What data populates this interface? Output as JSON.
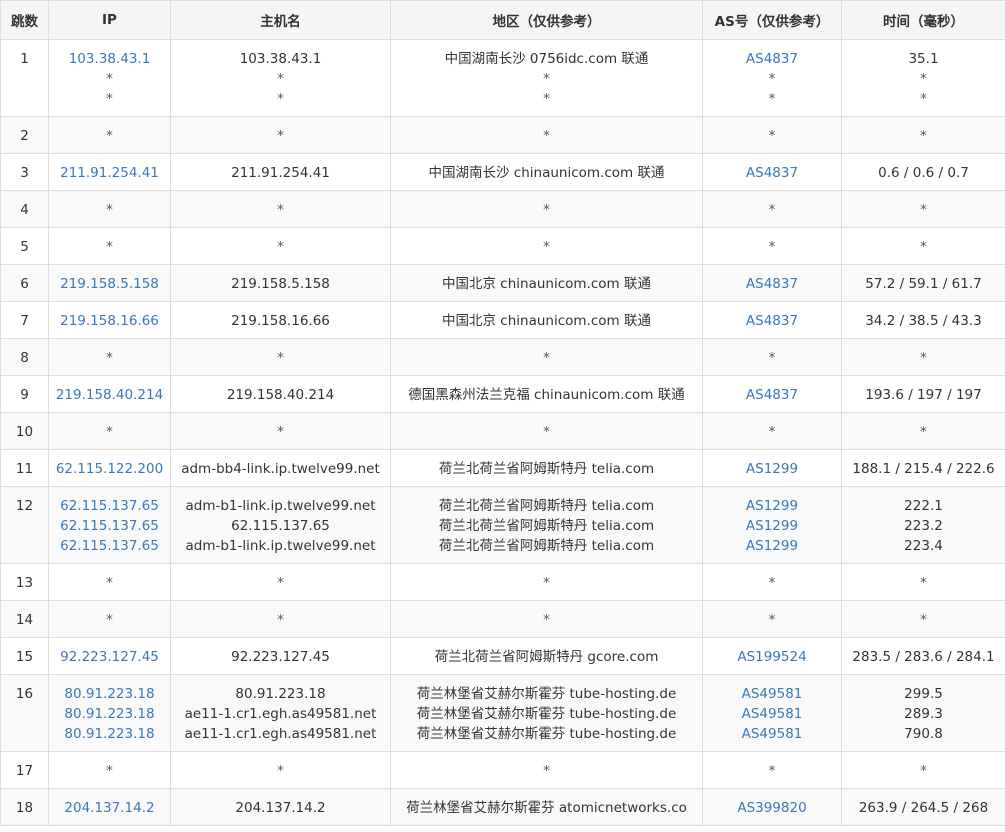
{
  "headers": [
    "跳数",
    "IP",
    "主机名",
    "地区（仅供参考）",
    "AS号（仅供参考）",
    "时间（毫秒）"
  ],
  "rows": [
    {
      "hop": "1",
      "ip": [
        "103.38.43.1",
        "*",
        "*"
      ],
      "host": [
        "103.38.43.1",
        "*",
        "*"
      ],
      "region": [
        "中国湖南长沙 0756idc.com 联通",
        "*",
        "*"
      ],
      "as": [
        "AS4837",
        "*",
        "*"
      ],
      "time": [
        "35.1",
        "*",
        "*"
      ]
    },
    {
      "hop": "2",
      "ip": [
        "*"
      ],
      "host": [
        "*"
      ],
      "region": [
        "*"
      ],
      "as": [
        "*"
      ],
      "time": [
        "*"
      ]
    },
    {
      "hop": "3",
      "ip": [
        "211.91.254.41"
      ],
      "host": [
        "211.91.254.41"
      ],
      "region": [
        "中国湖南长沙 chinaunicom.com 联通"
      ],
      "as": [
        "AS4837"
      ],
      "time": [
        "0.6 / 0.6 / 0.7"
      ]
    },
    {
      "hop": "4",
      "ip": [
        "*"
      ],
      "host": [
        "*"
      ],
      "region": [
        "*"
      ],
      "as": [
        "*"
      ],
      "time": [
        "*"
      ]
    },
    {
      "hop": "5",
      "ip": [
        "*"
      ],
      "host": [
        "*"
      ],
      "region": [
        "*"
      ],
      "as": [
        "*"
      ],
      "time": [
        "*"
      ]
    },
    {
      "hop": "6",
      "ip": [
        "219.158.5.158"
      ],
      "host": [
        "219.158.5.158"
      ],
      "region": [
        "中国北京 chinaunicom.com 联通"
      ],
      "as": [
        "AS4837"
      ],
      "time": [
        "57.2 / 59.1 / 61.7"
      ]
    },
    {
      "hop": "7",
      "ip": [
        "219.158.16.66"
      ],
      "host": [
        "219.158.16.66"
      ],
      "region": [
        "中国北京 chinaunicom.com 联通"
      ],
      "as": [
        "AS4837"
      ],
      "time": [
        "34.2 / 38.5 / 43.3"
      ]
    },
    {
      "hop": "8",
      "ip": [
        "*"
      ],
      "host": [
        "*"
      ],
      "region": [
        "*"
      ],
      "as": [
        "*"
      ],
      "time": [
        "*"
      ]
    },
    {
      "hop": "9",
      "ip": [
        "219.158.40.214"
      ],
      "host": [
        "219.158.40.214"
      ],
      "region": [
        "德国黑森州法兰克福 chinaunicom.com 联通"
      ],
      "as": [
        "AS4837"
      ],
      "time": [
        "193.6 / 197 / 197"
      ]
    },
    {
      "hop": "10",
      "ip": [
        "*"
      ],
      "host": [
        "*"
      ],
      "region": [
        "*"
      ],
      "as": [
        "*"
      ],
      "time": [
        "*"
      ]
    },
    {
      "hop": "11",
      "ip": [
        "62.115.122.200"
      ],
      "host": [
        "adm-bb4-link.ip.twelve99.net"
      ],
      "region": [
        "荷兰北荷兰省阿姆斯特丹 telia.com"
      ],
      "as": [
        "AS1299"
      ],
      "time": [
        "188.1 / 215.4 / 222.6"
      ]
    },
    {
      "hop": "12",
      "ip": [
        "62.115.137.65",
        "62.115.137.65",
        "62.115.137.65"
      ],
      "host": [
        "adm-b1-link.ip.twelve99.net",
        "62.115.137.65",
        "adm-b1-link.ip.twelve99.net"
      ],
      "region": [
        "荷兰北荷兰省阿姆斯特丹 telia.com",
        "荷兰北荷兰省阿姆斯特丹 telia.com",
        "荷兰北荷兰省阿姆斯特丹 telia.com"
      ],
      "as": [
        "AS1299",
        "AS1299",
        "AS1299"
      ],
      "time": [
        "222.1",
        "223.2",
        "223.4"
      ]
    },
    {
      "hop": "13",
      "ip": [
        "*"
      ],
      "host": [
        "*"
      ],
      "region": [
        "*"
      ],
      "as": [
        "*"
      ],
      "time": [
        "*"
      ]
    },
    {
      "hop": "14",
      "ip": [
        "*"
      ],
      "host": [
        "*"
      ],
      "region": [
        "*"
      ],
      "as": [
        "*"
      ],
      "time": [
        "*"
      ]
    },
    {
      "hop": "15",
      "ip": [
        "92.223.127.45"
      ],
      "host": [
        "92.223.127.45"
      ],
      "region": [
        "荷兰北荷兰省阿姆斯特丹 gcore.com"
      ],
      "as": [
        "AS199524"
      ],
      "time": [
        "283.5 / 283.6 / 284.1"
      ]
    },
    {
      "hop": "16",
      "ip": [
        "80.91.223.18",
        "80.91.223.18",
        "80.91.223.18"
      ],
      "host": [
        "80.91.223.18",
        "ae11-1.cr1.egh.as49581.net",
        "ae11-1.cr1.egh.as49581.net"
      ],
      "region": [
        "荷兰林堡省艾赫尔斯霍芬 tube-hosting.de",
        "荷兰林堡省艾赫尔斯霍芬 tube-hosting.de",
        "荷兰林堡省艾赫尔斯霍芬 tube-hosting.de"
      ],
      "as": [
        "AS49581",
        "AS49581",
        "AS49581"
      ],
      "time": [
        "299.5",
        "289.3",
        "790.8"
      ]
    },
    {
      "hop": "17",
      "ip": [
        "*"
      ],
      "host": [
        "*"
      ],
      "region": [
        "*"
      ],
      "as": [
        "*"
      ],
      "time": [
        "*"
      ]
    },
    {
      "hop": "18",
      "ip": [
        "204.137.14.2"
      ],
      "host": [
        "204.137.14.2"
      ],
      "region": [
        "荷兰林堡省艾赫尔斯霍芬 atomicnetworks.co"
      ],
      "as": [
        "AS399820"
      ],
      "time": [
        "263.9 / 264.5 / 268"
      ]
    }
  ],
  "colors": {
    "link": "#3a78b8",
    "header_bg": "#f5f5f5",
    "alt_row_bg": "#f9f9f9",
    "border": "#dddddd"
  }
}
